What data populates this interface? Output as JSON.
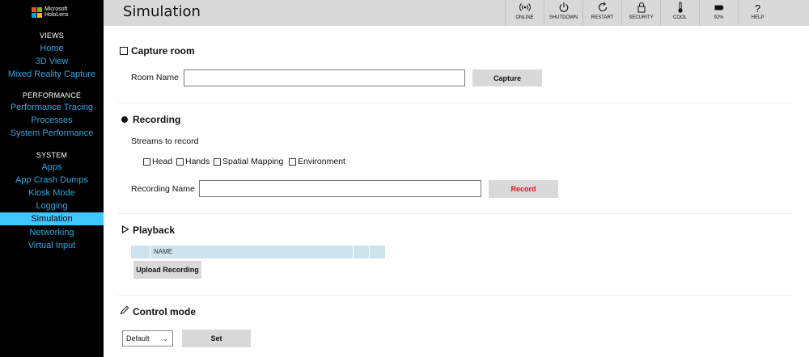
{
  "sidebar": {
    "logo_line1": "Microsoft",
    "logo_line2": "HoloLens",
    "sections": [
      {
        "title": "VIEWS",
        "items": [
          "Home",
          "3D View",
          "Mixed Reality Capture"
        ]
      },
      {
        "title": "PERFORMANCE",
        "items": [
          "Performance Tracing",
          "Processes",
          "System Performance"
        ]
      },
      {
        "title": "SYSTEM",
        "items": [
          "Apps",
          "App Crash Dumps",
          "Kiosk Mode",
          "Logging",
          "Simulation",
          "Networking",
          "Virtual Input"
        ]
      }
    ],
    "active_item": "Simulation"
  },
  "header": {
    "title": "Simulation",
    "buttons": [
      {
        "label": "ONLINE",
        "icon": "wireless-icon"
      },
      {
        "label": "SHUTDOWN",
        "icon": "power-icon"
      },
      {
        "label": "RESTART",
        "icon": "restart-icon"
      },
      {
        "label": "SECURITY",
        "icon": "lock-icon"
      },
      {
        "label": "COOL",
        "icon": "thermometer-icon"
      },
      {
        "label": "92%",
        "icon": "battery-icon"
      },
      {
        "label": "HELP",
        "icon": "help-icon"
      }
    ]
  },
  "capture_room": {
    "title": "Capture room",
    "room_name_label": "Room Name",
    "room_name_value": "",
    "capture_button": "Capture"
  },
  "recording": {
    "title": "Recording",
    "streams_label": "Streams to record",
    "streams": [
      "Head",
      "Hands",
      "Spatial Mapping",
      "Environment"
    ],
    "recording_name_label": "Recording Name",
    "recording_name_value": "",
    "record_button": "Record",
    "record_color": "#e81123"
  },
  "playback": {
    "title": "Playback",
    "table_headers": [
      "NAME",
      "",
      ""
    ],
    "upload_button": "Upload Recording"
  },
  "control_mode": {
    "title": "Control mode",
    "select_value": "Default",
    "set_button": "Set"
  },
  "colors": {
    "sidebar_bg": "#000000",
    "nav_link": "#2ea7e0",
    "nav_active_bg": "#3fc7ff",
    "header_bg": "#d9d9d9"
  }
}
